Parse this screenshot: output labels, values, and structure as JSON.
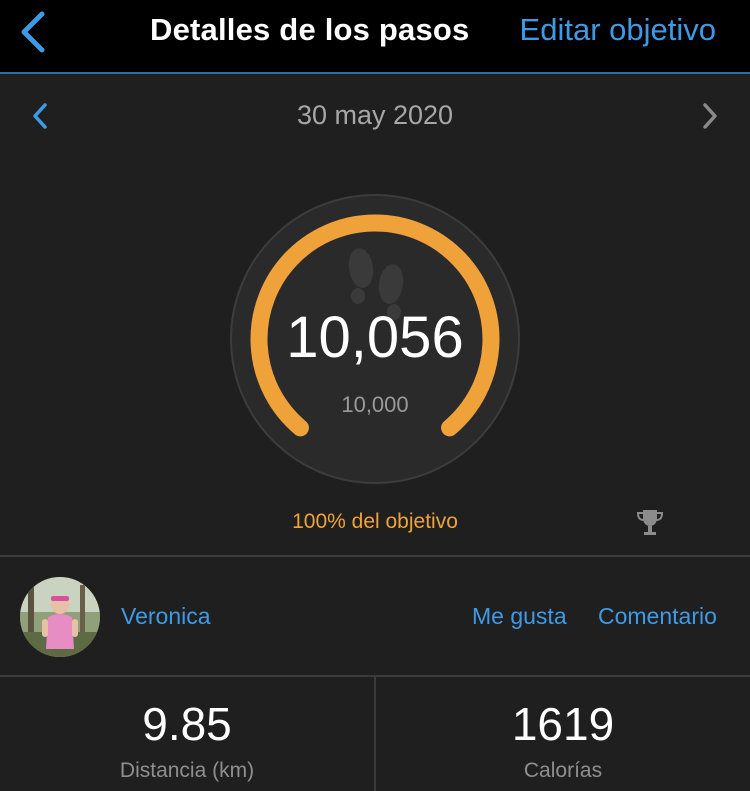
{
  "header": {
    "title": "Detalles de los pasos",
    "edit_label": "Editar objetivo"
  },
  "date_nav": {
    "date": "30 may 2020"
  },
  "progress": {
    "steps": "10,056",
    "goal": "10,000",
    "percent_label": "100% del objetivo",
    "completion_fraction": 1.0
  },
  "social": {
    "user_name": "Veronica",
    "like_label": "Me gusta",
    "comment_label": "Comentario"
  },
  "stats": {
    "distance_value": "9.85",
    "distance_label": "Distancia (km)",
    "calories_value": "1619",
    "calories_label": "Calorías"
  },
  "colors": {
    "accent": "#3f9ae5",
    "ring": "#f0a23a",
    "background": "#1f1f1f"
  },
  "icons": [
    "back-chevron-icon",
    "prev-day-icon",
    "next-day-icon",
    "footprints-icon",
    "trophy-icon"
  ]
}
